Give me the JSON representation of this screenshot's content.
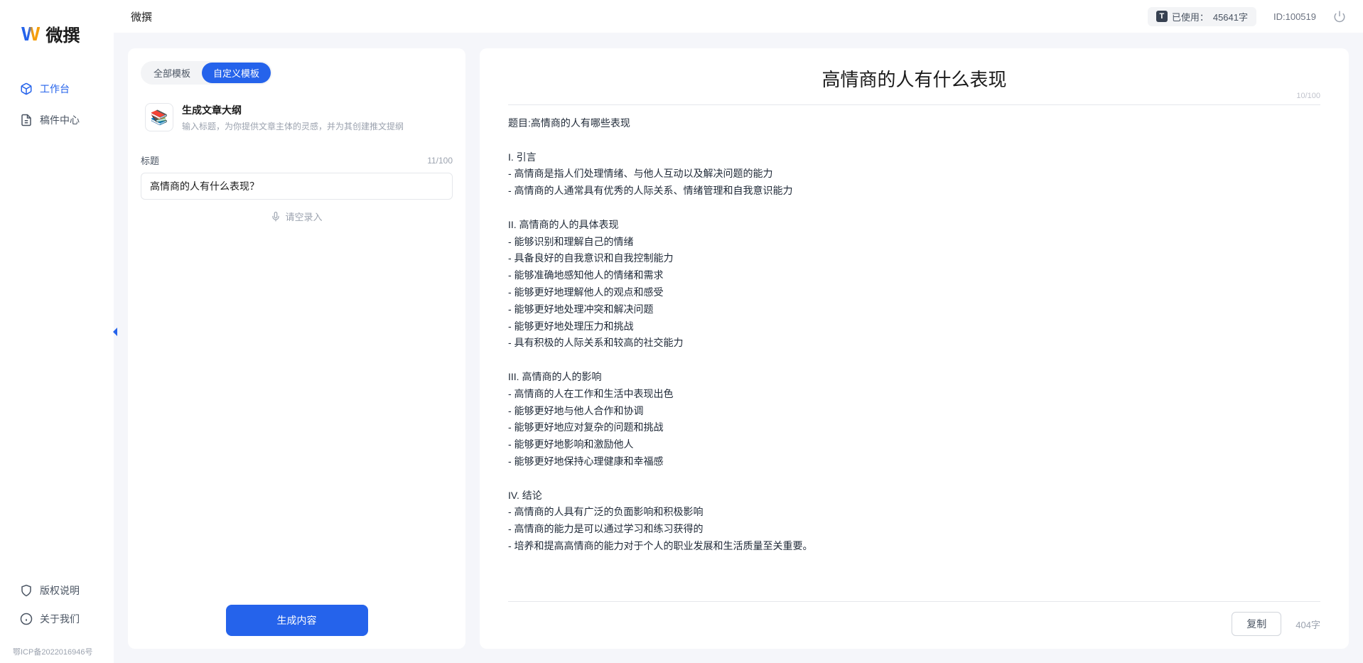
{
  "app_name": "微撰",
  "logo_text": "微撰",
  "sidebar": {
    "items": [
      {
        "label": "工作台"
      },
      {
        "label": "稿件中心"
      }
    ],
    "footer": [
      {
        "label": "版权说明"
      },
      {
        "label": "关于我们"
      }
    ],
    "icp": "鄂ICP备2022016946号"
  },
  "topbar": {
    "usage_label": "已使用：",
    "usage_value": "45641字",
    "id_text": "ID:100519"
  },
  "left": {
    "tabs": [
      {
        "label": "全部模板"
      },
      {
        "label": "自定义模板"
      }
    ],
    "template": {
      "name": "生成文章大纲",
      "desc": "输入标题，为你提供文章主体的灵感，并为其创建推文提纲"
    },
    "form": {
      "title_label": "标题",
      "title_count": "11/100",
      "title_value": "高情商的人有什么表现？",
      "voice_hint": "请空录入"
    },
    "generate_label": "生成内容"
  },
  "right": {
    "title": "高情商的人有什么表现",
    "title_count": "10/100",
    "body": "题目:高情商的人有哪些表现\n\nI. 引言\n- 高情商是指人们处理情绪、与他人互动以及解决问题的能力\n- 高情商的人通常具有优秀的人际关系、情绪管理和自我意识能力\n\nII. 高情商的人的具体表现\n- 能够识别和理解自己的情绪\n- 具备良好的自我意识和自我控制能力\n- 能够准确地感知他人的情绪和需求\n- 能够更好地理解他人的观点和感受\n- 能够更好地处理冲突和解决问题\n- 能够更好地处理压力和挑战\n- 具有积极的人际关系和较高的社交能力\n\nIII. 高情商的人的影响\n- 高情商的人在工作和生活中表现出色\n- 能够更好地与他人合作和协调\n- 能够更好地应对复杂的问题和挑战\n- 能够更好地影响和激励他人\n- 能够更好地保持心理健康和幸福感\n\nIV. 结论\n- 高情商的人具有广泛的负面影响和积极影响\n- 高情商的能力是可以通过学习和练习获得的\n- 培养和提高高情商的能力对于个人的职业发展和生活质量至关重要。",
    "copy_label": "复制",
    "word_count": "404字"
  }
}
